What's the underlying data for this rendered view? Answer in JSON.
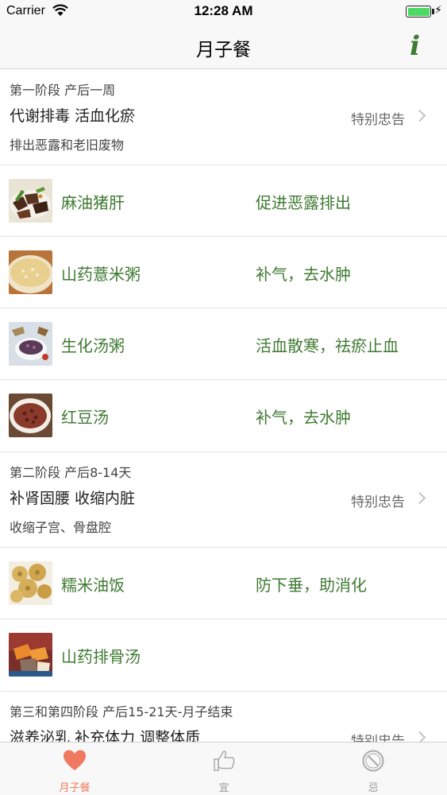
{
  "status_bar": {
    "carrier": "Carrier",
    "time": "12:28 AM"
  },
  "nav": {
    "title": "月子餐",
    "info_label": "i"
  },
  "sections": [
    {
      "stage": "第一阶段 产后一周",
      "title": "代谢排毒 活血化瘀",
      "warning": "特别忠告",
      "subtitle": "排出恶露和老旧废物",
      "foods": [
        {
          "name": "麻油猪肝",
          "effect": "促进恶露排出",
          "image": "sesame-pork-liver"
        },
        {
          "name": "山药薏米粥",
          "effect": "补气，去水肿",
          "image": "yam-barley-porridge"
        },
        {
          "name": "生化汤粥",
          "effect": "活血散寒，祛瘀止血",
          "image": "shenghua-soup-porridge"
        },
        {
          "name": "红豆汤",
          "effect": "补气，去水肿",
          "image": "red-bean-soup"
        }
      ]
    },
    {
      "stage": "第二阶段 产后8-14天",
      "title": "补肾固腰 收缩内脏",
      "warning": "特别忠告",
      "subtitle": "收缩子宫、骨盘腔",
      "foods": [
        {
          "name": "糯米油饭",
          "effect": "防下垂，助消化",
          "image": "glutinous-rice"
        },
        {
          "name": "山药排骨汤",
          "effect": "",
          "image": "yam-ribs-soup"
        }
      ]
    },
    {
      "stage": "第三和第四阶段 产后15-21天-月子结束",
      "title": "滋养泌乳 补充体力 调整体质",
      "warning": "特别忠告"
    }
  ],
  "tabs": [
    {
      "label": "月子餐",
      "icon": "heart-icon",
      "active": true
    },
    {
      "label": "宜",
      "icon": "thumbs-up-icon",
      "active": false
    },
    {
      "label": "忌",
      "icon": "prohibited-icon",
      "active": false
    }
  ],
  "colors": {
    "accent_green": "#3f7a32",
    "tab_active": "#f07a5f",
    "tab_inactive": "#999999"
  }
}
